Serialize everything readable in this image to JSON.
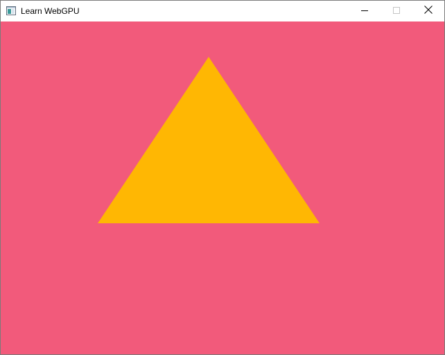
{
  "window": {
    "title": "Learn WebGPU",
    "icon": "app-window-icon",
    "controls": {
      "minimize_icon": "minimize-icon",
      "maximize_icon": "maximize-icon",
      "close_icon": "close-icon"
    }
  },
  "canvas": {
    "clear_color": "#f25a7b",
    "shape": {
      "type": "triangle",
      "fill": "#ffb703"
    }
  }
}
